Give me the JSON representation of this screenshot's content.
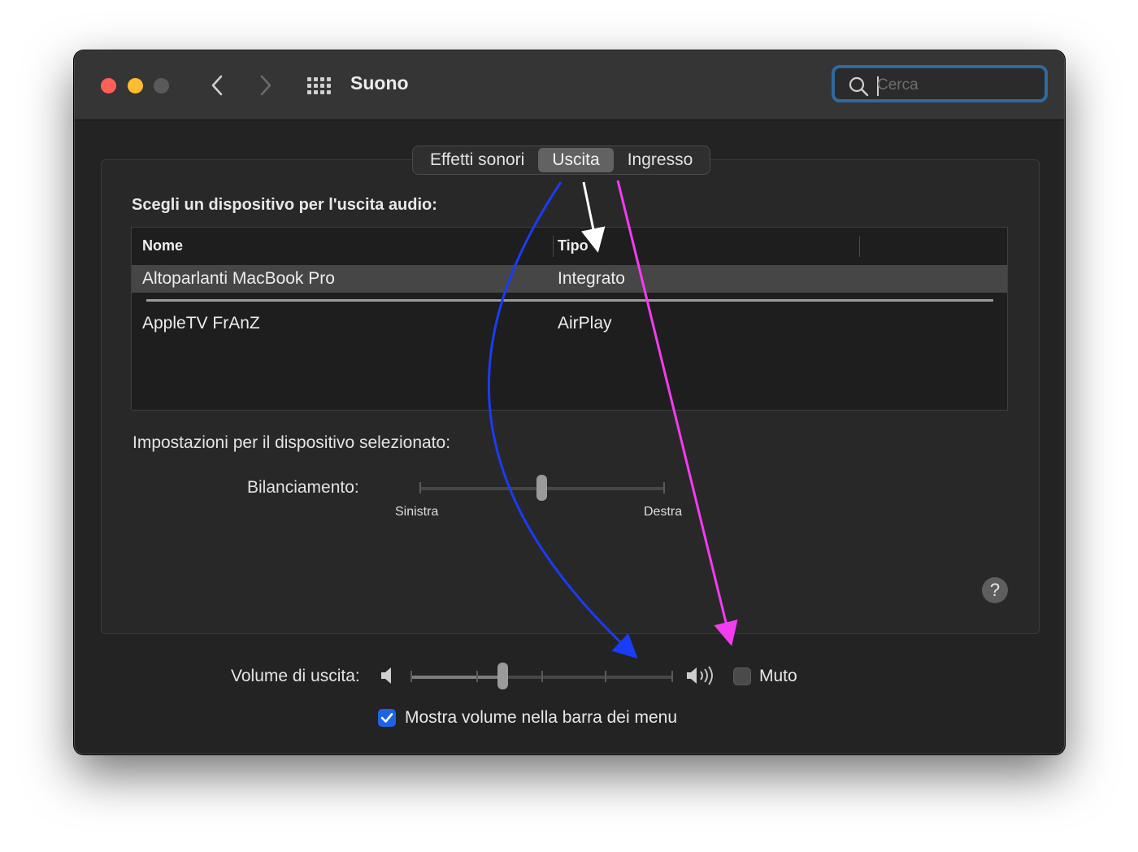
{
  "window": {
    "title": "Suono",
    "search": {
      "placeholder": "Cerca",
      "value": ""
    }
  },
  "tabs": [
    {
      "label": "Effetti sonori",
      "active": false
    },
    {
      "label": "Uscita",
      "active": true
    },
    {
      "label": "Ingresso",
      "active": false
    }
  ],
  "output": {
    "choose_label": "Scegli un dispositivo per l'uscita audio:",
    "columns": [
      "Nome",
      "Tipo"
    ],
    "devices": [
      {
        "name": "Altoparlanti MacBook Pro",
        "type": "Integrato",
        "selected": true
      },
      {
        "name": "AppleTV FrAnZ",
        "type": "AirPlay",
        "selected": false
      }
    ],
    "settings_label": "Impostazioni per il dispositivo selezionato:",
    "balance": {
      "label": "Bilanciamento:",
      "left_label": "Sinistra",
      "right_label": "Destra",
      "value": 0.5
    }
  },
  "volume": {
    "label": "Volume di uscita:",
    "value": 0.35,
    "mute_label": "Muto",
    "muted": false,
    "show_in_menubar_label": "Mostra volume nella barra dei menu",
    "show_in_menubar": true
  },
  "help": {
    "label": "?"
  },
  "colors": {
    "accent_checkbox": "#1d63e6",
    "search_focus": "#2e6a9e",
    "arrow_blue": "#1a3cf5",
    "arrow_white": "#ffffff",
    "arrow_magenta": "#f23cf0"
  }
}
